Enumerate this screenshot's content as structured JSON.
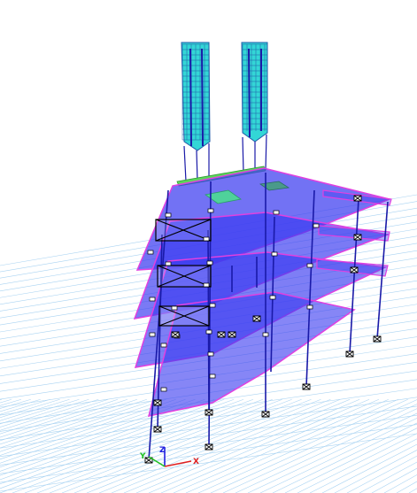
{
  "viewport": {
    "background": "#ffffff"
  },
  "colors": {
    "grid": "#a9d3f2",
    "slab_fill": "#3b3bf0",
    "slab_edge": "#e040e0",
    "column": "#1a1aa8",
    "shell_fill": "#33d6d6",
    "shell_line": "#1e5aa8",
    "roof_green": "#5cd65c",
    "support": "#000000"
  },
  "axes": {
    "x_label": "X",
    "y_label": "Y",
    "z_label": "Z",
    "x_color": "#e02020",
    "y_color": "#20c020",
    "z_color": "#2020e0"
  },
  "model": {
    "story_slabs": 4,
    "roof_level": 1,
    "tower_shells": 2,
    "braced_bays": 3,
    "icons": [
      "support-icon",
      "joint-icon",
      "brace-icon"
    ]
  }
}
